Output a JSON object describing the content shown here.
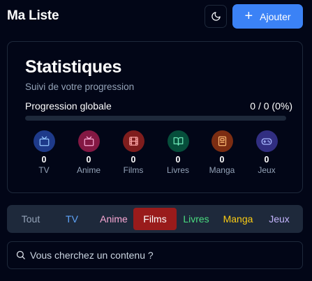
{
  "header": {
    "title": "Ma Liste",
    "theme_icon": "moon-icon",
    "add_label": "Ajouter"
  },
  "stats": {
    "title": "Statistiques",
    "subtitle": "Suivi de votre progression",
    "progress_label": "Progression globale",
    "progress_value": "0 / 0 (0%)",
    "progress_fraction": 0,
    "categories": [
      {
        "key": "tv",
        "icon": "tv-icon",
        "count": "0",
        "label": "TV",
        "bg": "#1e3a8a",
        "fg": "#93c5fd"
      },
      {
        "key": "anime",
        "icon": "tv-icon",
        "count": "0",
        "label": "Anime",
        "bg": "#831843",
        "fg": "#f9a8d4"
      },
      {
        "key": "films",
        "icon": "film-icon",
        "count": "0",
        "label": "Films",
        "bg": "#7f1d1d",
        "fg": "#fca5a5"
      },
      {
        "key": "livres",
        "icon": "book-open-icon",
        "count": "0",
        "label": "Livres",
        "bg": "#064e3b",
        "fg": "#6ee7b7"
      },
      {
        "key": "manga",
        "icon": "book-icon",
        "count": "0",
        "label": "Manga",
        "bg": "#7c2d12",
        "fg": "#fdba74"
      },
      {
        "key": "jeux",
        "icon": "gamepad-icon",
        "count": "0",
        "label": "Jeux",
        "bg": "#312e81",
        "fg": "#a5b4fc"
      }
    ]
  },
  "filters": {
    "tabs": [
      {
        "label": "Tout",
        "color": "#94a3b8"
      },
      {
        "label": "TV",
        "color": "#60a5fa"
      },
      {
        "label": "Anime",
        "color": "#f9a8d4"
      },
      {
        "label": "Films",
        "color": "#fca5a5"
      },
      {
        "label": "Livres",
        "color": "#4ade80"
      },
      {
        "label": "Manga",
        "color": "#facc15"
      },
      {
        "label": "Jeux",
        "color": "#c4b5fd"
      }
    ],
    "active": "Films"
  },
  "search": {
    "placeholder": "Vous cherchez un contenu ?",
    "value": ""
  },
  "colors": {
    "background": "#020617",
    "accent": "#3b82f6",
    "active_filter": "#991b1b"
  }
}
